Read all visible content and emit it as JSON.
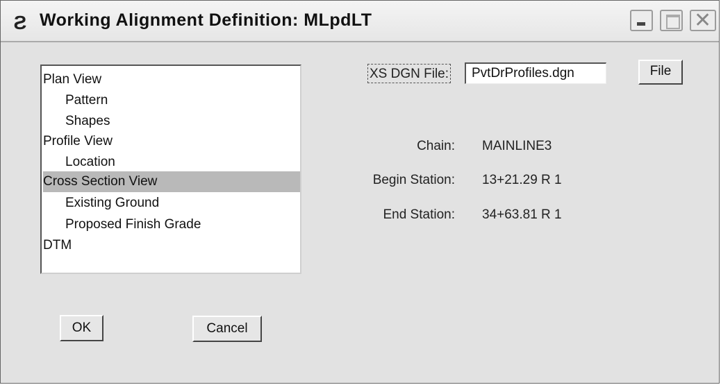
{
  "window": {
    "title": "Working Alignment Definition: MLpdLT",
    "icon": "microstation-icon"
  },
  "tree": {
    "items": [
      {
        "label": "Plan View",
        "level": 0
      },
      {
        "label": "Pattern",
        "level": 1
      },
      {
        "label": "Shapes",
        "level": 1
      },
      {
        "label": "Profile View",
        "level": 0
      },
      {
        "label": "Location",
        "level": 1
      },
      {
        "label": "Cross Section View",
        "level": 0,
        "selected": true
      },
      {
        "label": "Existing Ground",
        "level": 1
      },
      {
        "label": "Proposed Finish Grade",
        "level": 1
      },
      {
        "label": "DTM",
        "level": 0
      }
    ]
  },
  "xs_dgn": {
    "label": "XS DGN File:",
    "value": "PvtDrProfiles.dgn",
    "file_button": "File"
  },
  "info": {
    "chain_label": "Chain:",
    "chain_value": "MAINLINE3",
    "begin_label": "Begin Station:",
    "begin_value": "13+21.29 R 1",
    "end_label": "End Station:",
    "end_value": "34+63.81 R 1"
  },
  "buttons": {
    "ok": "OK",
    "cancel": "Cancel"
  },
  "colors": {
    "selection": "#b9b9b9",
    "dialog_bg": "#e2e2e2"
  }
}
